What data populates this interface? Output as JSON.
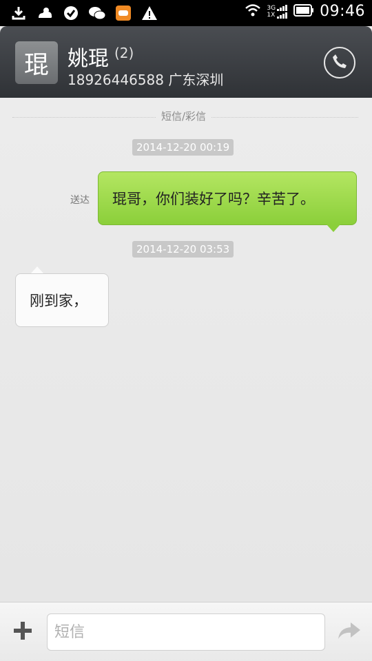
{
  "status_bar": {
    "time": "09:46",
    "network_top": "3G",
    "network_bottom": "1X",
    "icons": [
      "download-icon",
      "weather-icon",
      "check-icon",
      "wechat-icon",
      "game-icon",
      "warning-icon",
      "wifi-icon",
      "signal-icon",
      "battery-icon"
    ]
  },
  "header": {
    "avatar_char": "琨",
    "name": "姚琨",
    "count": "(2)",
    "subtitle": "18926446588 广东深圳",
    "call_icon": "phone-icon"
  },
  "conversation": {
    "divider_label": "短信/彩信",
    "messages": [
      {
        "timestamp": "2014-12-20 00:19",
        "direction": "out",
        "status": "送达",
        "text": "琨哥，你们装好了吗？辛苦了。"
      },
      {
        "timestamp": "2014-12-20 03:53",
        "direction": "in",
        "text": "刚到家，"
      }
    ]
  },
  "input_bar": {
    "placeholder": "短信",
    "plus_icon": "plus-icon",
    "send_icon": "send-icon"
  },
  "colors": {
    "header_bg": "#3b3e42",
    "outgoing_bubble": "#9dd84c",
    "incoming_bubble": "#fbfbfb",
    "background": "#ececec"
  }
}
